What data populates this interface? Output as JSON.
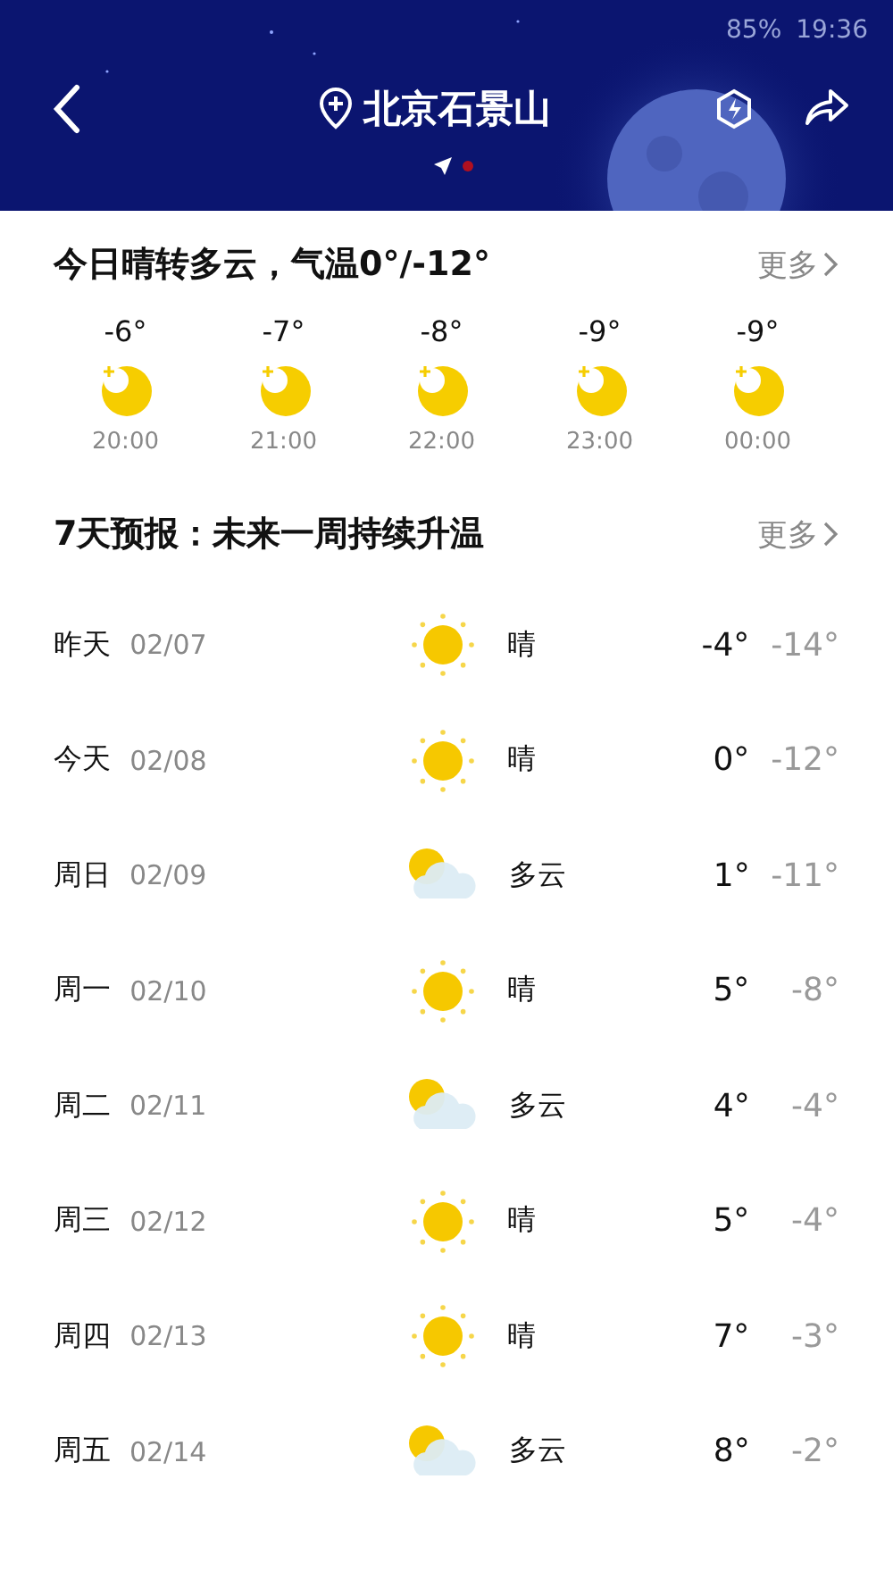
{
  "status_bar": {
    "battery": "85%",
    "time": "19:36"
  },
  "header": {
    "city": "北京石景山",
    "pages": [
      {
        "kind": "location",
        "selected": false
      },
      {
        "kind": "dot",
        "selected": true
      }
    ]
  },
  "today": {
    "title": "今日晴转多云，气温0°/-12°",
    "more": "更多",
    "hours": [
      {
        "temp": "-6°",
        "time": "20:00",
        "kind": "moon"
      },
      {
        "temp": "-7°",
        "time": "21:00",
        "kind": "moon"
      },
      {
        "temp": "-8°",
        "time": "22:00",
        "kind": "moon"
      },
      {
        "temp": "-9°",
        "time": "23:00",
        "kind": "moon"
      },
      {
        "temp": "-9°",
        "time": "00:00",
        "kind": "moon"
      }
    ]
  },
  "forecast": {
    "title": "7天预报：未来一周持续升温",
    "more": "更多",
    "days": [
      {
        "day": "昨天",
        "date": "02/07",
        "kind": "sunny",
        "weather": "晴",
        "high": "-4°",
        "low": "-14°"
      },
      {
        "day": "今天",
        "date": "02/08",
        "kind": "sunny",
        "weather": "晴",
        "high": "0°",
        "low": "-12°"
      },
      {
        "day": "周日",
        "date": "02/09",
        "kind": "cloudy",
        "weather": "多云",
        "high": "1°",
        "low": "-11°"
      },
      {
        "day": "周一",
        "date": "02/10",
        "kind": "sunny",
        "weather": "晴",
        "high": "5°",
        "low": "-8°"
      },
      {
        "day": "周二",
        "date": "02/11",
        "kind": "cloudy",
        "weather": "多云",
        "high": "4°",
        "low": "-4°"
      },
      {
        "day": "周三",
        "date": "02/12",
        "kind": "sunny",
        "weather": "晴",
        "high": "5°",
        "low": "-4°"
      },
      {
        "day": "周四",
        "date": "02/13",
        "kind": "sunny",
        "weather": "晴",
        "high": "7°",
        "low": "-3°"
      },
      {
        "day": "周五",
        "date": "02/14",
        "kind": "cloudy",
        "weather": "多云",
        "high": "8°",
        "low": "-2°"
      }
    ]
  }
}
